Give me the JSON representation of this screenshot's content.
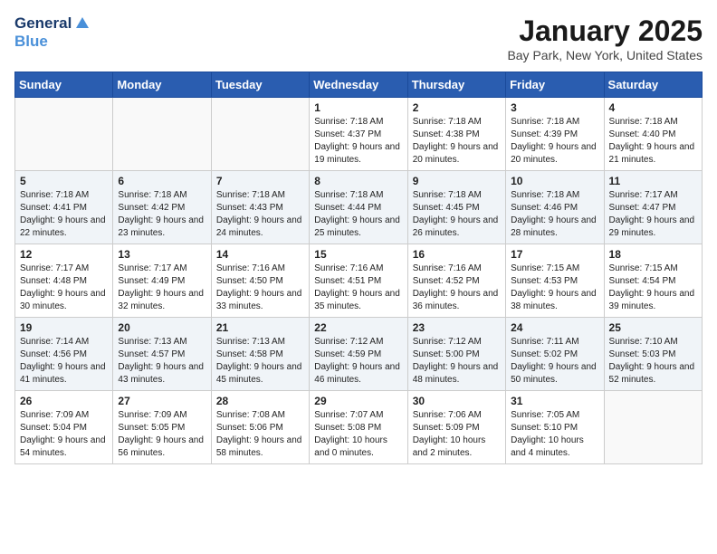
{
  "header": {
    "logo_line1": "General",
    "logo_line2": "Blue",
    "month": "January 2025",
    "location": "Bay Park, New York, United States"
  },
  "weekdays": [
    "Sunday",
    "Monday",
    "Tuesday",
    "Wednesday",
    "Thursday",
    "Friday",
    "Saturday"
  ],
  "weeks": [
    [
      {
        "day": "",
        "sunrise": "",
        "sunset": "",
        "daylight": ""
      },
      {
        "day": "",
        "sunrise": "",
        "sunset": "",
        "daylight": ""
      },
      {
        "day": "",
        "sunrise": "",
        "sunset": "",
        "daylight": ""
      },
      {
        "day": "1",
        "sunrise": "Sunrise: 7:18 AM",
        "sunset": "Sunset: 4:37 PM",
        "daylight": "Daylight: 9 hours and 19 minutes."
      },
      {
        "day": "2",
        "sunrise": "Sunrise: 7:18 AM",
        "sunset": "Sunset: 4:38 PM",
        "daylight": "Daylight: 9 hours and 20 minutes."
      },
      {
        "day": "3",
        "sunrise": "Sunrise: 7:18 AM",
        "sunset": "Sunset: 4:39 PM",
        "daylight": "Daylight: 9 hours and 20 minutes."
      },
      {
        "day": "4",
        "sunrise": "Sunrise: 7:18 AM",
        "sunset": "Sunset: 4:40 PM",
        "daylight": "Daylight: 9 hours and 21 minutes."
      }
    ],
    [
      {
        "day": "5",
        "sunrise": "Sunrise: 7:18 AM",
        "sunset": "Sunset: 4:41 PM",
        "daylight": "Daylight: 9 hours and 22 minutes."
      },
      {
        "day": "6",
        "sunrise": "Sunrise: 7:18 AM",
        "sunset": "Sunset: 4:42 PM",
        "daylight": "Daylight: 9 hours and 23 minutes."
      },
      {
        "day": "7",
        "sunrise": "Sunrise: 7:18 AM",
        "sunset": "Sunset: 4:43 PM",
        "daylight": "Daylight: 9 hours and 24 minutes."
      },
      {
        "day": "8",
        "sunrise": "Sunrise: 7:18 AM",
        "sunset": "Sunset: 4:44 PM",
        "daylight": "Daylight: 9 hours and 25 minutes."
      },
      {
        "day": "9",
        "sunrise": "Sunrise: 7:18 AM",
        "sunset": "Sunset: 4:45 PM",
        "daylight": "Daylight: 9 hours and 26 minutes."
      },
      {
        "day": "10",
        "sunrise": "Sunrise: 7:18 AM",
        "sunset": "Sunset: 4:46 PM",
        "daylight": "Daylight: 9 hours and 28 minutes."
      },
      {
        "day": "11",
        "sunrise": "Sunrise: 7:17 AM",
        "sunset": "Sunset: 4:47 PM",
        "daylight": "Daylight: 9 hours and 29 minutes."
      }
    ],
    [
      {
        "day": "12",
        "sunrise": "Sunrise: 7:17 AM",
        "sunset": "Sunset: 4:48 PM",
        "daylight": "Daylight: 9 hours and 30 minutes."
      },
      {
        "day": "13",
        "sunrise": "Sunrise: 7:17 AM",
        "sunset": "Sunset: 4:49 PM",
        "daylight": "Daylight: 9 hours and 32 minutes."
      },
      {
        "day": "14",
        "sunrise": "Sunrise: 7:16 AM",
        "sunset": "Sunset: 4:50 PM",
        "daylight": "Daylight: 9 hours and 33 minutes."
      },
      {
        "day": "15",
        "sunrise": "Sunrise: 7:16 AM",
        "sunset": "Sunset: 4:51 PM",
        "daylight": "Daylight: 9 hours and 35 minutes."
      },
      {
        "day": "16",
        "sunrise": "Sunrise: 7:16 AM",
        "sunset": "Sunset: 4:52 PM",
        "daylight": "Daylight: 9 hours and 36 minutes."
      },
      {
        "day": "17",
        "sunrise": "Sunrise: 7:15 AM",
        "sunset": "Sunset: 4:53 PM",
        "daylight": "Daylight: 9 hours and 38 minutes."
      },
      {
        "day": "18",
        "sunrise": "Sunrise: 7:15 AM",
        "sunset": "Sunset: 4:54 PM",
        "daylight": "Daylight: 9 hours and 39 minutes."
      }
    ],
    [
      {
        "day": "19",
        "sunrise": "Sunrise: 7:14 AM",
        "sunset": "Sunset: 4:56 PM",
        "daylight": "Daylight: 9 hours and 41 minutes."
      },
      {
        "day": "20",
        "sunrise": "Sunrise: 7:13 AM",
        "sunset": "Sunset: 4:57 PM",
        "daylight": "Daylight: 9 hours and 43 minutes."
      },
      {
        "day": "21",
        "sunrise": "Sunrise: 7:13 AM",
        "sunset": "Sunset: 4:58 PM",
        "daylight": "Daylight: 9 hours and 45 minutes."
      },
      {
        "day": "22",
        "sunrise": "Sunrise: 7:12 AM",
        "sunset": "Sunset: 4:59 PM",
        "daylight": "Daylight: 9 hours and 46 minutes."
      },
      {
        "day": "23",
        "sunrise": "Sunrise: 7:12 AM",
        "sunset": "Sunset: 5:00 PM",
        "daylight": "Daylight: 9 hours and 48 minutes."
      },
      {
        "day": "24",
        "sunrise": "Sunrise: 7:11 AM",
        "sunset": "Sunset: 5:02 PM",
        "daylight": "Daylight: 9 hours and 50 minutes."
      },
      {
        "day": "25",
        "sunrise": "Sunrise: 7:10 AM",
        "sunset": "Sunset: 5:03 PM",
        "daylight": "Daylight: 9 hours and 52 minutes."
      }
    ],
    [
      {
        "day": "26",
        "sunrise": "Sunrise: 7:09 AM",
        "sunset": "Sunset: 5:04 PM",
        "daylight": "Daylight: 9 hours and 54 minutes."
      },
      {
        "day": "27",
        "sunrise": "Sunrise: 7:09 AM",
        "sunset": "Sunset: 5:05 PM",
        "daylight": "Daylight: 9 hours and 56 minutes."
      },
      {
        "day": "28",
        "sunrise": "Sunrise: 7:08 AM",
        "sunset": "Sunset: 5:06 PM",
        "daylight": "Daylight: 9 hours and 58 minutes."
      },
      {
        "day": "29",
        "sunrise": "Sunrise: 7:07 AM",
        "sunset": "Sunset: 5:08 PM",
        "daylight": "Daylight: 10 hours and 0 minutes."
      },
      {
        "day": "30",
        "sunrise": "Sunrise: 7:06 AM",
        "sunset": "Sunset: 5:09 PM",
        "daylight": "Daylight: 10 hours and 2 minutes."
      },
      {
        "day": "31",
        "sunrise": "Sunrise: 7:05 AM",
        "sunset": "Sunset: 5:10 PM",
        "daylight": "Daylight: 10 hours and 4 minutes."
      },
      {
        "day": "",
        "sunrise": "",
        "sunset": "",
        "daylight": ""
      }
    ]
  ]
}
